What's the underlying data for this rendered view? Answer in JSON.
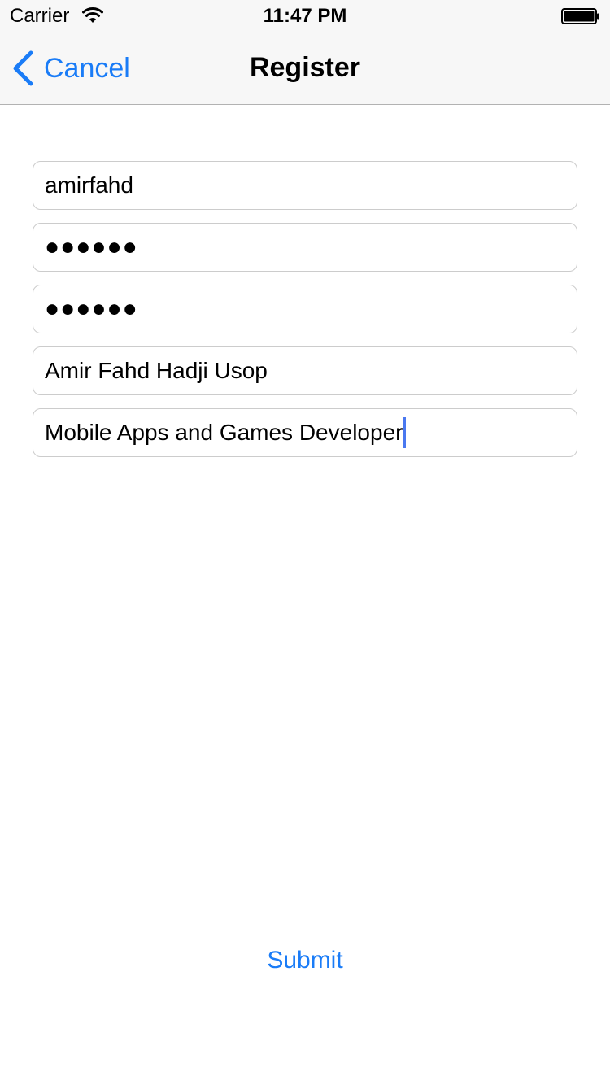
{
  "status_bar": {
    "carrier": "Carrier",
    "time": "11:47 PM"
  },
  "nav": {
    "back_label": "Cancel",
    "title": "Register"
  },
  "form": {
    "username": "amirfahd",
    "password": "●●●●●●",
    "confirm_password": "●●●●●●",
    "full_name": "Amir Fahd Hadji Usop",
    "occupation": "Mobile Apps and Games Developer"
  },
  "submit_label": "Submit",
  "colors": {
    "accent": "#1a7cf7",
    "caret": "#4a78f0",
    "bar_background": "#f7f7f7",
    "field_border": "#cccccc"
  },
  "icons": {
    "wifi": "wifi-icon",
    "battery": "battery-icon",
    "back": "chevron-left-icon"
  }
}
